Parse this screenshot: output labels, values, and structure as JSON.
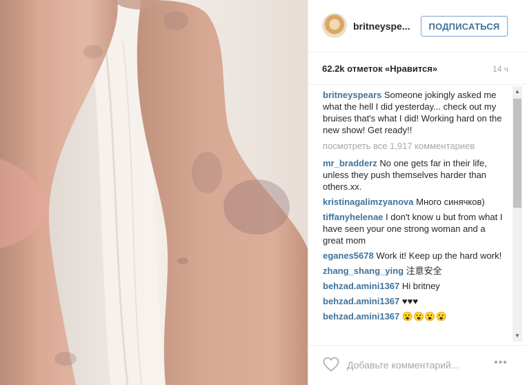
{
  "post": {
    "username": "britneyspe...",
    "follow_label": "ПОДПИСАТЬСЯ",
    "likes": "62.2k отметок «Нравится»",
    "time": "14 ч"
  },
  "caption": {
    "author": "britneyspears",
    "text": " Someone jokingly asked me what the hell I did yesterday... check out my bruises that's what I did! Working hard on the new show! Get ready!!"
  },
  "view_all": "посмотреть все 1,917 комментариев",
  "comments": [
    {
      "author": "mr_bradderz",
      "text": " No one gets far in their life, unless they push themselves harder than others.xx."
    },
    {
      "author": "kristinagalimzyanova",
      "text": " Много синячков)"
    },
    {
      "author": "tiffanyhelenae",
      "text": " I don't know u but from what I have seen your one strong woman and a great mom"
    },
    {
      "author": "eganes5678",
      "text": " Work it! Keep up the hard work!"
    },
    {
      "author": "zhang_shang_ying",
      "text": " 注意安全"
    },
    {
      "author": "behzad.amini1367",
      "text": " Hi britney"
    },
    {
      "author": "behzad.amini1367",
      "text": " ♥♥♥"
    },
    {
      "author": "behzad.amini1367",
      "text": " 😮😮😮😮"
    }
  ],
  "footer": {
    "comment_placeholder": "Добавьте комментарий...",
    "more_label": "•••"
  },
  "icons": {
    "heart": "heart-icon",
    "more": "ellipsis-icon",
    "scroll_up": "scroll-up-arrow-icon",
    "scroll_down": "scroll-down-arrow-icon"
  },
  "colors": {
    "link": "#3f729b",
    "muted": "#a5a7aa",
    "text": "#262626"
  }
}
